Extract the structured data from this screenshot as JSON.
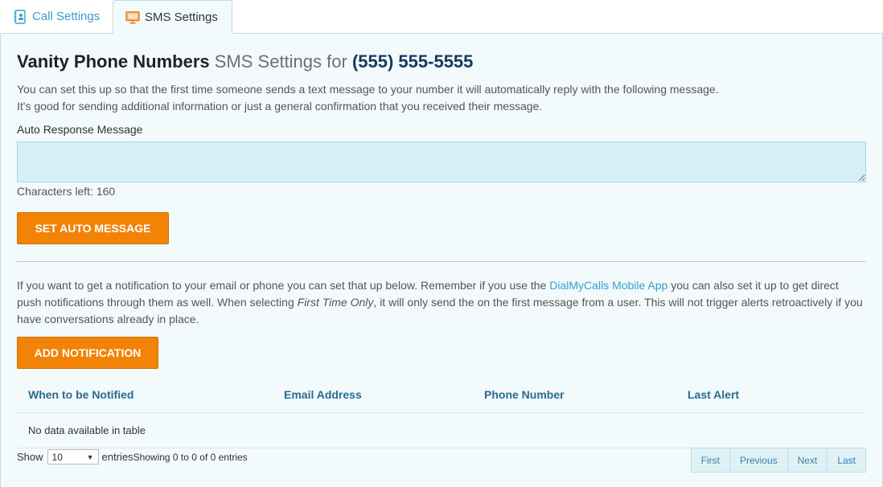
{
  "tabs": [
    {
      "label": "Call Settings",
      "icon": "notebook-icon",
      "active": false
    },
    {
      "label": "SMS Settings",
      "icon": "monitor-icon",
      "active": true
    }
  ],
  "header": {
    "title_main": "Vanity Phone Numbers",
    "title_sub": "SMS Settings for",
    "phone": "(555) 555-5555"
  },
  "intro": {
    "line1": "You can set this up so that the first time someone sends a text message to your number it will automatically reply with the following message.",
    "line2": "It's good for sending additional information or just a general confirmation that you received their message."
  },
  "auto_response": {
    "label": "Auto Response Message",
    "value": "",
    "chars_left": "Characters left: 160",
    "button": "SET AUTO MESSAGE"
  },
  "notification": {
    "text_before": "If you want to get a notification to your email or phone you can set that up below. Remember if you use the ",
    "link": "DialMyCalls Mobile App",
    "text_middle": " you can also set it up to get direct push notifications through them as well. When selecting ",
    "emphasis": "First Time Only",
    "text_after": ", it will only send the on the first message from a user. This will not trigger alerts retroactively if you have conversations already in place.",
    "button": "ADD NOTIFICATION"
  },
  "table": {
    "columns": [
      "When to be Notified",
      "Email Address",
      "Phone Number",
      "Last Alert"
    ],
    "empty": "No data available in table"
  },
  "footer": {
    "show": "Show",
    "page_size": "10",
    "entries": "entries",
    "info": "Showing 0 to 0 of 0 entries",
    "pager": [
      "First",
      "Previous",
      "Next",
      "Last"
    ]
  },
  "colors": {
    "accent": "#f28306",
    "link": "#3a9ec9",
    "panel_bg": "#f2fafc",
    "phone_color": "#16385e"
  }
}
